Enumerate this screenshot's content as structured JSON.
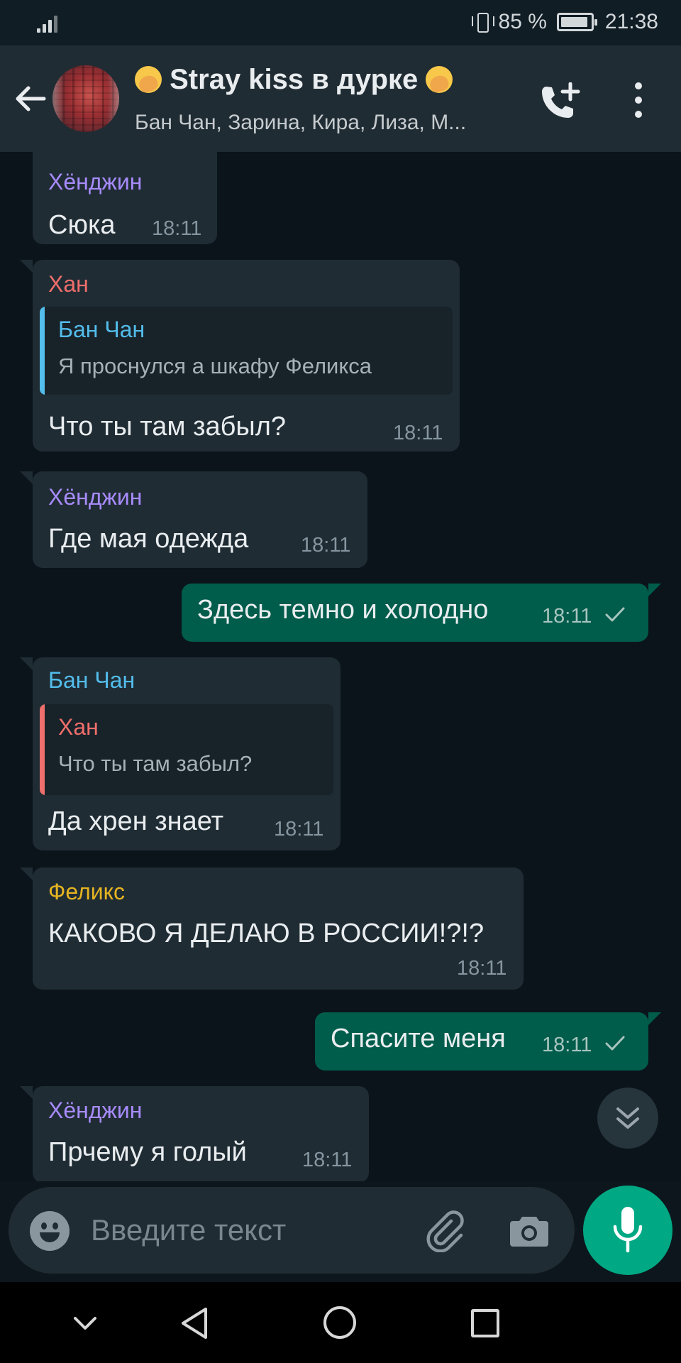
{
  "status_bar": {
    "battery": "85 %",
    "time": "21:38"
  },
  "header": {
    "title": "Stray kiss в дурке",
    "subtitle": "Бан Чан, Зарина, Кира, Лиза, М..."
  },
  "colors": {
    "hyunjin": "#a78bfa",
    "han": "#ef6f6c",
    "bangchan": "#53bdeb",
    "felix": "#e6b422",
    "accent": "#00a884",
    "outgoing_bubble": "#005c4b",
    "incoming_bubble": "#1f2c34"
  },
  "messages": [
    {
      "sender": "Хёнджин",
      "text": "Сюка",
      "time": "18:11"
    },
    {
      "sender": "Хан",
      "reply": {
        "sender": "Бан Чан",
        "text": "Я проснулся а шкафу Феликса"
      },
      "text": "Что ты там забыл?",
      "time": "18:11"
    },
    {
      "sender": "Хёнджин",
      "text": "Где мая одежда",
      "time": "18:11"
    },
    {
      "text": "Здесь темно и холодно",
      "time": "18:11",
      "status_icon": "check-icon"
    },
    {
      "sender": "Бан Чан",
      "reply": {
        "sender": "Хан",
        "text": "Что ты там забыл?"
      },
      "text": "Да хрен знает",
      "time": "18:11"
    },
    {
      "sender": "Феликс",
      "text": "КАКОВО Я ДЕЛАЮ В РОССИИ!?!?",
      "time": "18:11"
    },
    {
      "text": "Спасите меня",
      "time": "18:11",
      "status_icon": "check-icon"
    },
    {
      "sender": "Хёнджин",
      "text": "Прчему я голый",
      "time": "18:11"
    }
  ],
  "input": {
    "placeholder": "Введите текст"
  }
}
